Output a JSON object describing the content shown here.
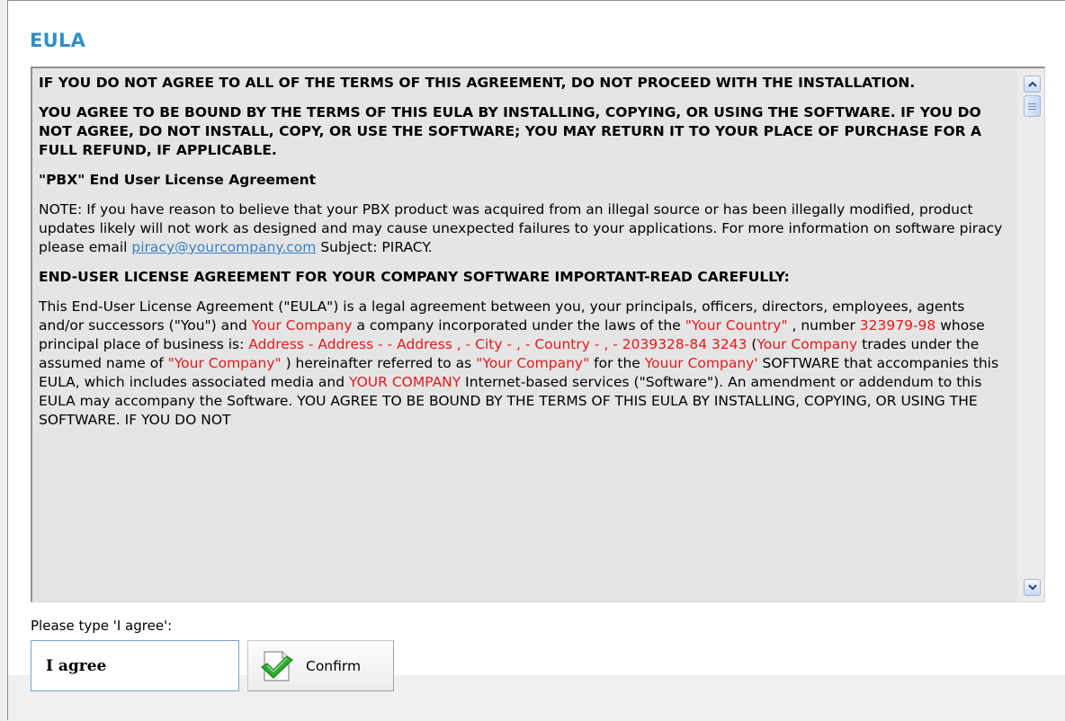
{
  "title": "EULA",
  "eula": {
    "p1": "IF YOU DO NOT AGREE TO ALL OF THE TERMS OF THIS AGREEMENT, DO NOT PROCEED WITH THE INSTALLATION.",
    "p2": "YOU AGREE TO BE BOUND BY THE TERMS OF THIS EULA BY INSTALLING, COPYING, OR USING THE SOFTWARE. IF YOU DO NOT AGREE, DO NOT INSTALL, COPY, OR USE THE SOFTWARE; YOU MAY RETURN IT TO YOUR PLACE OF PURCHASE FOR A FULL REFUND, IF APPLICABLE.",
    "p3": "\"PBX\" End User License Agreement",
    "note_before": "NOTE: If you have reason to believe that your PBX product was acquired from an illegal source or has been illegally modified, product updates likely will not work as designed and may cause unexpected failures to your applications. For more information on software piracy please email ",
    "note_link": "piracy@yourcompany.com",
    "note_after": " Subject: PIRACY.",
    "p5": "END-USER LICENSE AGREEMENT FOR YOUR COMPANY SOFTWARE IMPORTANT-READ CAREFULLY:",
    "p6": {
      "t1": "This End-User License Agreement (\"EULA\") is a legal agreement between you, your principals, officers, directors, employees, agents and/or successors (\"You\") and ",
      "r1": " Your Company ",
      "t2": " a company incorporated under the laws of the ",
      "r2": "\"Your Country\"",
      "t3": " , number ",
      "r3": "323979-98",
      "t4": " whose principal place of business is: ",
      "r4": "Address - Address - - Address , - City - , - Country - , - 2039328-84 3243",
      "t5": " (",
      "r5": "Your Company",
      "t6": " trades under the assumed name of ",
      "r6": "\"Your Company\"",
      "t7": " ) hereinafter referred to as ",
      "r7": "\"Your Company\"",
      "t8": " for the ",
      "r8": "Youur Company'",
      "t9": " SOFTWARE that accompanies this EULA, which includes associated media and ",
      "r9": "YOUR COMPANY",
      "t10": " Internet-based services (\"Software\"). An amendment or addendum to this EULA may accompany the Software. YOU AGREE TO BE BOUND BY THE TERMS OF THIS EULA BY INSTALLING, COPYING, OR USING THE SOFTWARE. IF YOU DO NOT"
    }
  },
  "prompt_label": "Please type 'I agree':",
  "agree_input_value": "I agree",
  "confirm_label": "Confirm",
  "icons": {
    "confirm": "green-check-document-icon",
    "scroll_up": "chevron-up-icon",
    "scroll_down": "chevron-down-icon"
  },
  "colors": {
    "title": "#2f8fc5",
    "highlight": "#e8191a",
    "link": "#3b7fc8"
  }
}
